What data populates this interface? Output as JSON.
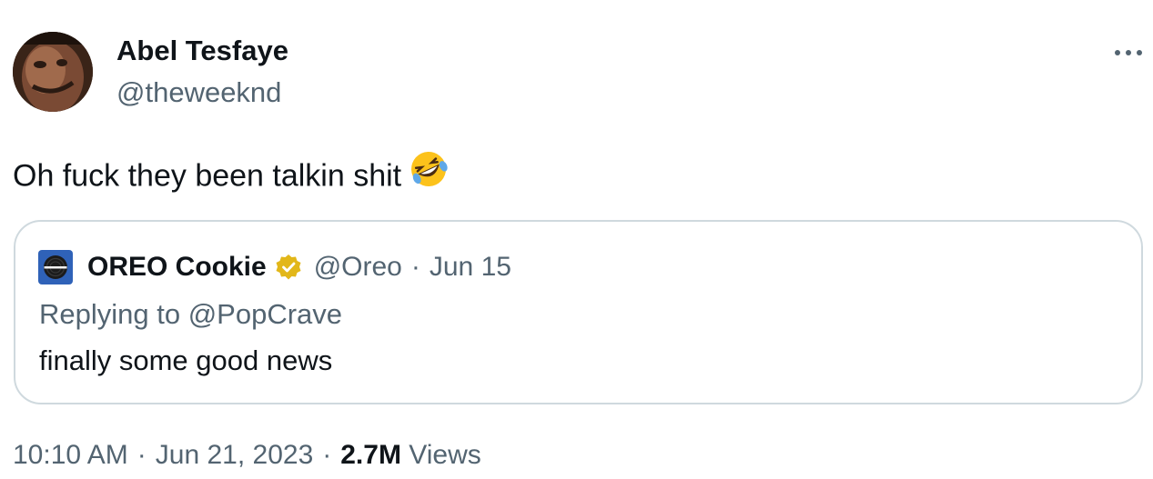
{
  "tweet": {
    "author": {
      "display_name": "Abel Tesfaye",
      "handle": "@theweeknd",
      "avatar_icon": "avatar-photo-icon"
    },
    "more_icon": "more-options-icon",
    "text": "Oh fuck they been talkin shit",
    "emoji": "rolling-on-floor-laughing-emoji",
    "quoted": {
      "author_name": "OREO Cookie",
      "verified_icon": "gold-verified-badge-icon",
      "handle": "@Oreo",
      "separator": "·",
      "date": "Jun 15",
      "reply_context": "Replying to @PopCrave",
      "text": "finally some good news"
    },
    "meta": {
      "time": "10:10 AM",
      "separator": "·",
      "date": "Jun 21, 2023",
      "separator2": "·",
      "views_count": "2.7M",
      "views_label": "Views"
    }
  },
  "colors": {
    "text_primary": "#0f1419",
    "text_secondary": "#536471",
    "border": "#cfd9de",
    "verified_gold": "#e2b719",
    "oreo_blue": "#2f62b8"
  }
}
